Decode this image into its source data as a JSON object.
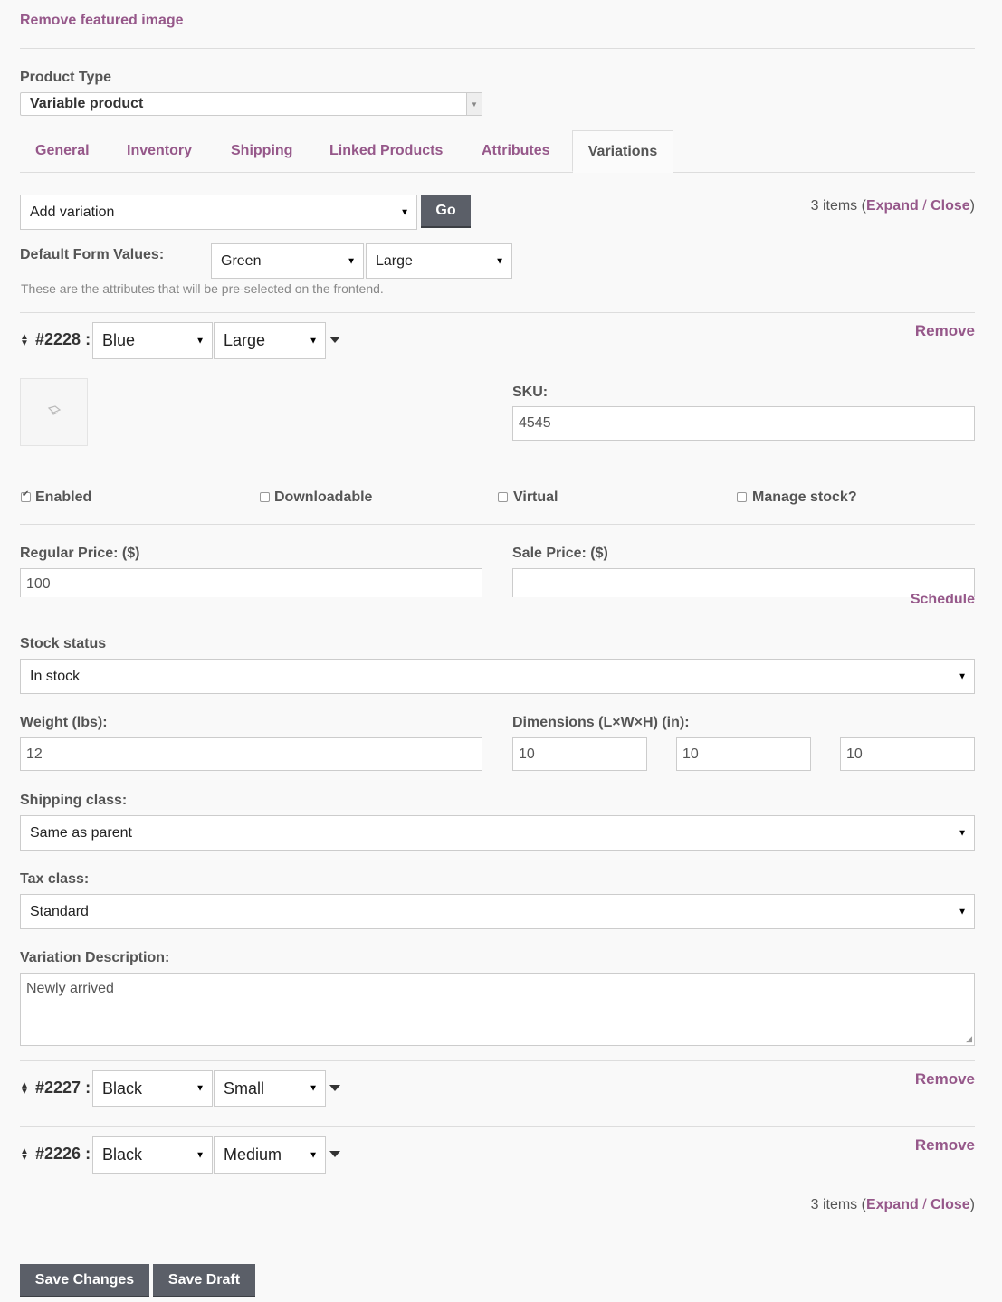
{
  "remove_featured_image": "Remove featured image",
  "product_type": {
    "label": "Product Type",
    "value": "Variable product"
  },
  "tabs": [
    {
      "label": "General"
    },
    {
      "label": "Inventory"
    },
    {
      "label": "Shipping"
    },
    {
      "label": "Linked Products"
    },
    {
      "label": "Attributes"
    },
    {
      "label": "Variations",
      "active": true
    }
  ],
  "toolbar": {
    "add_variation": "Add variation",
    "go": "Go",
    "count_text": "3 items (",
    "expand": "Expand",
    "slash": " / ",
    "close": "Close",
    "close_paren": ")"
  },
  "default_form": {
    "label": "Default Form Values:",
    "color": "Green",
    "size": "Large",
    "hint": "These are the attributes that will be pre-selected on the frontend."
  },
  "variations": [
    {
      "id": "#2228 :",
      "color": "Blue",
      "size": "Large",
      "remove": "Remove",
      "sku_label": "SKU:",
      "sku": "4545",
      "enabled": "Enabled",
      "downloadable": "Downloadable",
      "virtual": "Virtual",
      "manage_stock": "Manage stock?",
      "regular_price_label": "Regular Price: ($)",
      "regular_price": "100",
      "sale_price_label": "Sale Price: ($)",
      "sale_price": "",
      "schedule": "Schedule",
      "stock_status_label": "Stock status",
      "stock_status": "In stock",
      "weight_label": "Weight (lbs):",
      "weight": "12",
      "dimensions_label": "Dimensions (L×W×H) (in):",
      "length": "10",
      "width": "10",
      "height": "10",
      "shipping_class_label": "Shipping class:",
      "shipping_class": "Same as parent",
      "tax_class_label": "Tax class:",
      "tax_class": "Standard",
      "description_label": "Variation Description:",
      "description": "Newly arrived"
    },
    {
      "id": "#2227 :",
      "color": "Black",
      "size": "Small",
      "remove": "Remove"
    },
    {
      "id": "#2226 :",
      "color": "Black",
      "size": "Medium",
      "remove": "Remove"
    }
  ],
  "footer": {
    "count_text": "3 items (",
    "expand": "Expand",
    "slash": " / ",
    "close": "Close",
    "close_paren": ")",
    "save_changes": "Save Changes",
    "save_draft": "Save Draft"
  },
  "colors": {
    "accent": "#96588a",
    "button": "#5b5f68"
  }
}
